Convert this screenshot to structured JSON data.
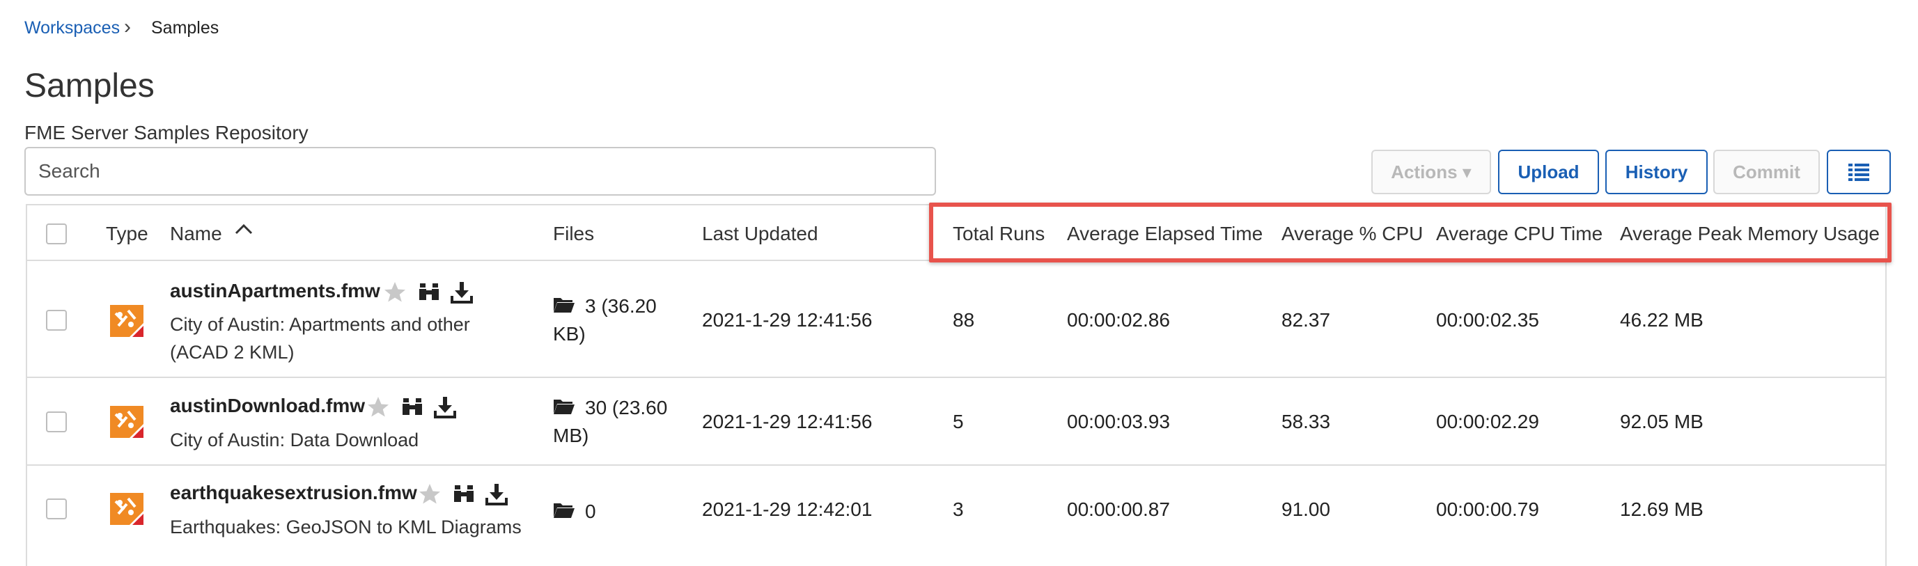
{
  "breadcrumb": {
    "parent": "Workspaces",
    "separator": "›",
    "current": "Samples"
  },
  "page_title": "Samples",
  "repository_description": "FME Server Samples Repository",
  "search": {
    "placeholder": "Search",
    "value": ""
  },
  "toolbar": {
    "actions_label": "Actions ▾",
    "upload_label": "Upload",
    "history_label": "History",
    "commit_label": "Commit"
  },
  "table": {
    "headers": {
      "type": "Type",
      "name": "Name",
      "files": "Files",
      "last_updated": "Last Updated",
      "total_runs": "Total Runs",
      "avg_elapsed": "Average Elapsed Time",
      "avg_cpu_pct": "Average % CPU",
      "avg_cpu_time": "Average CPU Time",
      "avg_peak_memory": "Average Peak Memory Usage"
    },
    "sort": {
      "column": "Name",
      "direction": "ascending"
    },
    "rows": [
      {
        "name": "austinApartments.fmw",
        "description_line1": "City of Austin: Apartments and other",
        "description_line2": "(ACAD 2 KML)",
        "files_line1": "3 (36.20",
        "files_line2": "KB)",
        "last_updated": "2021-1-29 12:41:56",
        "total_runs": "88",
        "avg_elapsed": "00:00:02.86",
        "avg_cpu_pct": "82.37",
        "avg_cpu_time": "00:00:02.35",
        "avg_peak_memory": "46.22 MB"
      },
      {
        "name": "austinDownload.fmw",
        "description_line1": "City of Austin: Data Download",
        "files_line1": "30 (23.60",
        "files_line2": "MB)",
        "last_updated": "2021-1-29 12:41:56",
        "total_runs": "5",
        "avg_elapsed": "00:00:03.93",
        "avg_cpu_pct": "58.33",
        "avg_cpu_time": "00:00:02.29",
        "avg_peak_memory": "92.05 MB"
      },
      {
        "name": "earthquakesextrusion.fmw",
        "description_line1": "Earthquakes: GeoJSON to KML Diagrams",
        "files_line1": "0",
        "last_updated": "2021-1-29 12:42:01",
        "total_runs": "3",
        "avg_elapsed": "00:00:00.87",
        "avg_cpu_pct": "91.00",
        "avg_cpu_time": "00:00:00.79",
        "avg_peak_memory": "12.69 MB"
      }
    ]
  },
  "icons": {
    "workspace": "fme-workspace-icon",
    "favorite": "star-icon",
    "inspect": "binoculars-icon",
    "download": "download-icon",
    "folder": "folder-icon",
    "sort": "chevron-up-icon",
    "view_toggle": "list-view-icon"
  },
  "colors": {
    "link": "#1a5fb4",
    "highlight_border": "#e8534c",
    "workspace_icon_orange": "#f08a24",
    "workspace_icon_red": "#d9262c",
    "star": "#c8c8c8"
  }
}
